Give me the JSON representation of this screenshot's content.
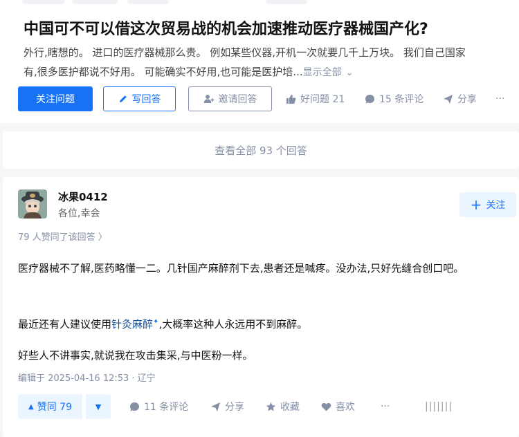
{
  "question": {
    "title": "中国可不可以借这次贸易战的机会加速推动医疗器械国产化?",
    "excerpt_line1": "外行,瞎想的。 进口的医疗器械那么贵。 例如某些仪器,开机一次就要几千上万块。 我们自己国家",
    "excerpt_line2": "有,很多医护都说不好用。 可能确实不好用,也可能是医护培...",
    "show_all": "显示全部",
    "follow_btn": "关注问题",
    "answer_btn": "写回答",
    "invite_btn": "邀请回答",
    "good_question": "好问题 21",
    "comments": "15 条评论",
    "share": "分享",
    "more": "···"
  },
  "view_all_answers": "查看全部 93 个回答",
  "answer": {
    "author_name": "冰果0412",
    "author_bio": "各位,幸会",
    "follow": "关注",
    "votes_line": "79 人赞同了该回答 〉",
    "p1": "医疗器械不了解,医药略懂一二。几针国产麻醉剂下去,患者还是喊疼。没办法,只好先缝合创口吧。",
    "p2_prefix": "最近还有人建议使用",
    "p2_link": "针灸麻醉",
    "p2_suffix": ",大概率这种人永远用不到麻醉。",
    "p3": "好些人不讲事实,就说我在攻击集采,与中医粉一样。",
    "edit_time": "编辑于 2025-04-16 12:53 · 辽宁",
    "vote_up": "赞同 79",
    "comments": "11 条评论",
    "share": "分享",
    "collect": "收藏",
    "like": "喜欢",
    "more": "···",
    "watermark": "|||||||"
  },
  "colors": {
    "brand": "#1772f6",
    "meta_gray": "#8590a6",
    "link": "#175199"
  }
}
